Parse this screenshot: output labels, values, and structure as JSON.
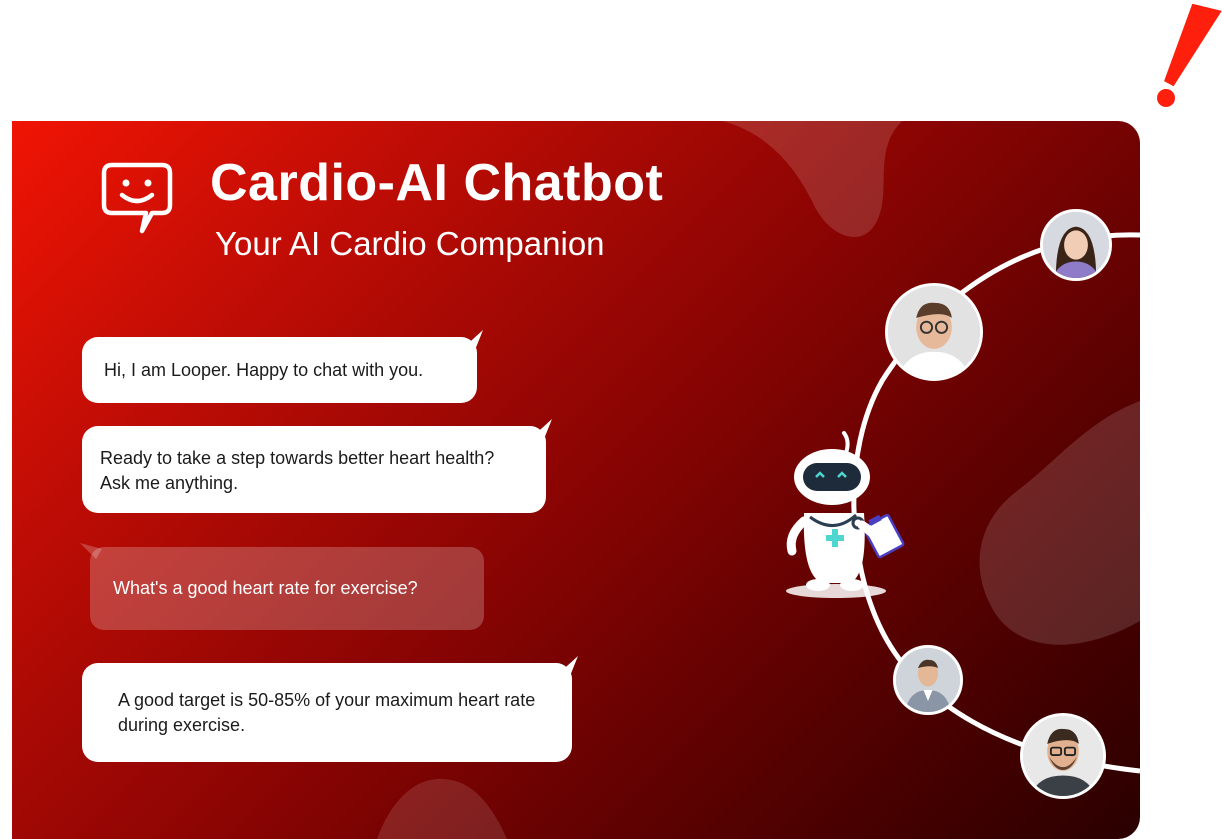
{
  "header": {
    "title": "Cardio-AI Chatbot",
    "subtitle": "Your AI Cardio Companion"
  },
  "chat": {
    "messages": [
      {
        "role": "bot",
        "text": "Hi, I am Looper. Happy to chat with you."
      },
      {
        "role": "bot",
        "text": "Ready to take a step towards better heart health? Ask me anything."
      },
      {
        "role": "user",
        "text": "What's a good heart rate for exercise?"
      },
      {
        "role": "bot",
        "text": "A good target is 50-85% of your maximum heart rate during exercise."
      }
    ]
  },
  "icons": {
    "logo": "chat-smiley-icon",
    "mascot": "robot-doctor-icon",
    "mark": "exclamation-icon"
  },
  "colors": {
    "brand_red": "#f01404",
    "brand_dark": "#2a0000",
    "bubble_bg": "#ffffff",
    "accent_teal": "#4fd6d0"
  }
}
